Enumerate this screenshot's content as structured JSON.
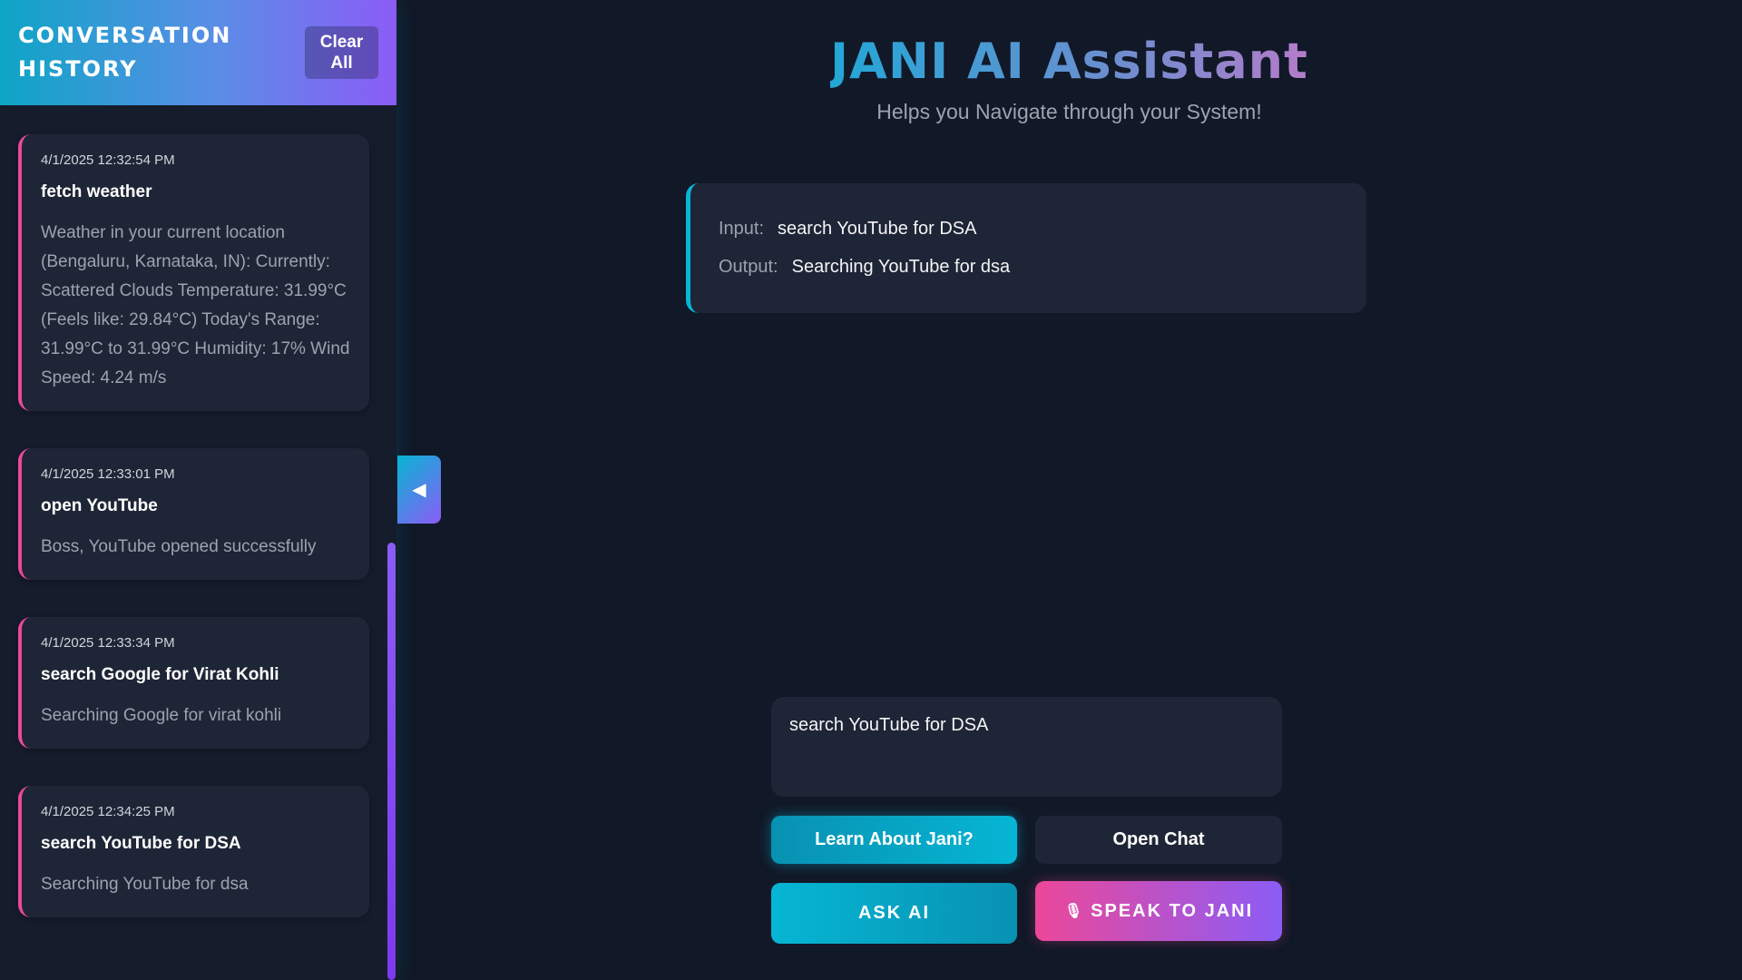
{
  "sidebar": {
    "title": "CONVERSATION HISTORY",
    "clear_label": "Clear All",
    "items": [
      {
        "time": "4/1/2025 12:32:54 PM",
        "query": "fetch weather",
        "response": "Weather in your current location (Bengaluru, Karnataka, IN): Currently: Scattered Clouds Temperature: 31.99°C (Feels like: 29.84°C) Today's Range: 31.99°C to 31.99°C Humidity: 17% Wind Speed: 4.24 m/s"
      },
      {
        "time": "4/1/2025 12:33:01 PM",
        "query": "open YouTube",
        "response": "Boss, YouTube opened successfully"
      },
      {
        "time": "4/1/2025 12:33:34 PM",
        "query": "search Google for Virat Kohli",
        "response": "Searching Google for virat kohli"
      },
      {
        "time": "4/1/2025 12:34:25 PM",
        "query": "search YouTube for DSA",
        "response": "Searching YouTube for dsa"
      }
    ]
  },
  "toggle": {
    "icon": "collapse-left-icon",
    "glyph": "◀"
  },
  "main": {
    "title": "JANI AI Assistant",
    "subtitle": "Helps you Navigate through your System!",
    "io": {
      "input_label": "Input:",
      "input_value": "search YouTube for DSA",
      "output_label": "Output:",
      "output_value": "Searching YouTube for dsa"
    },
    "query_value": "search YouTube for DSA",
    "buttons": {
      "learn": "Learn About Jani?",
      "chat": "Open Chat",
      "ask": "ASK AI",
      "speak": "SPEAK TO JANI",
      "mic_icon": "microphone-icon",
      "mic_glyph": "🎙"
    }
  },
  "colors": {
    "background": "#111827",
    "card": "#1e2536",
    "accent_cyan": "#06b6d4",
    "accent_pink": "#ec4899",
    "accent_purple": "#8b5cf6"
  }
}
